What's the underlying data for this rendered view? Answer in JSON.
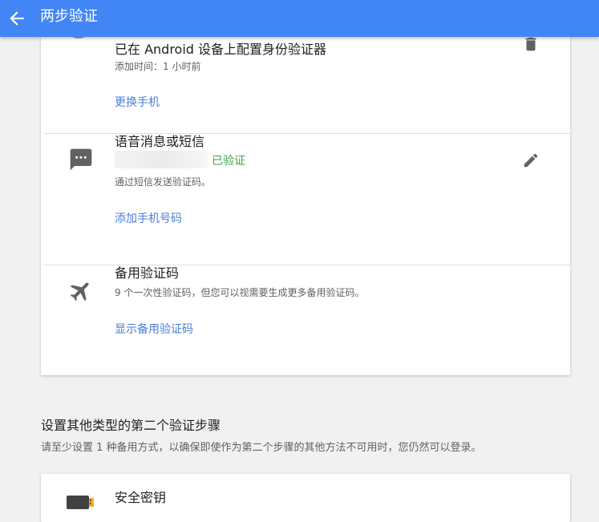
{
  "header": {
    "title": "两步验证"
  },
  "authenticator": {
    "title": "已在 Android 设备上配置身份验证器",
    "added_time": "添加时间：1 小时前",
    "link": "更换手机"
  },
  "voice_sms": {
    "title": "语音消息或短信",
    "status": "已验证",
    "description": "通过短信发送验证码。",
    "link": "添加手机号码"
  },
  "backup_codes": {
    "title": "备用验证码",
    "description": "9 个一次性验证码，但您可以视需要生成更多备用验证码。",
    "link": "显示备用验证码"
  },
  "other_methods": {
    "heading": "设置其他类型的第二个验证步骤",
    "description": "请至少设置 1 种备用方式，以确保即使作为第二个步骤的其他方法不可用时，您仍然可以登录。"
  },
  "security_key": {
    "title": "安全密钥"
  },
  "colors": {
    "app_bar": "#4285f4",
    "link": "#4a7fd9",
    "verified": "#43a047"
  }
}
